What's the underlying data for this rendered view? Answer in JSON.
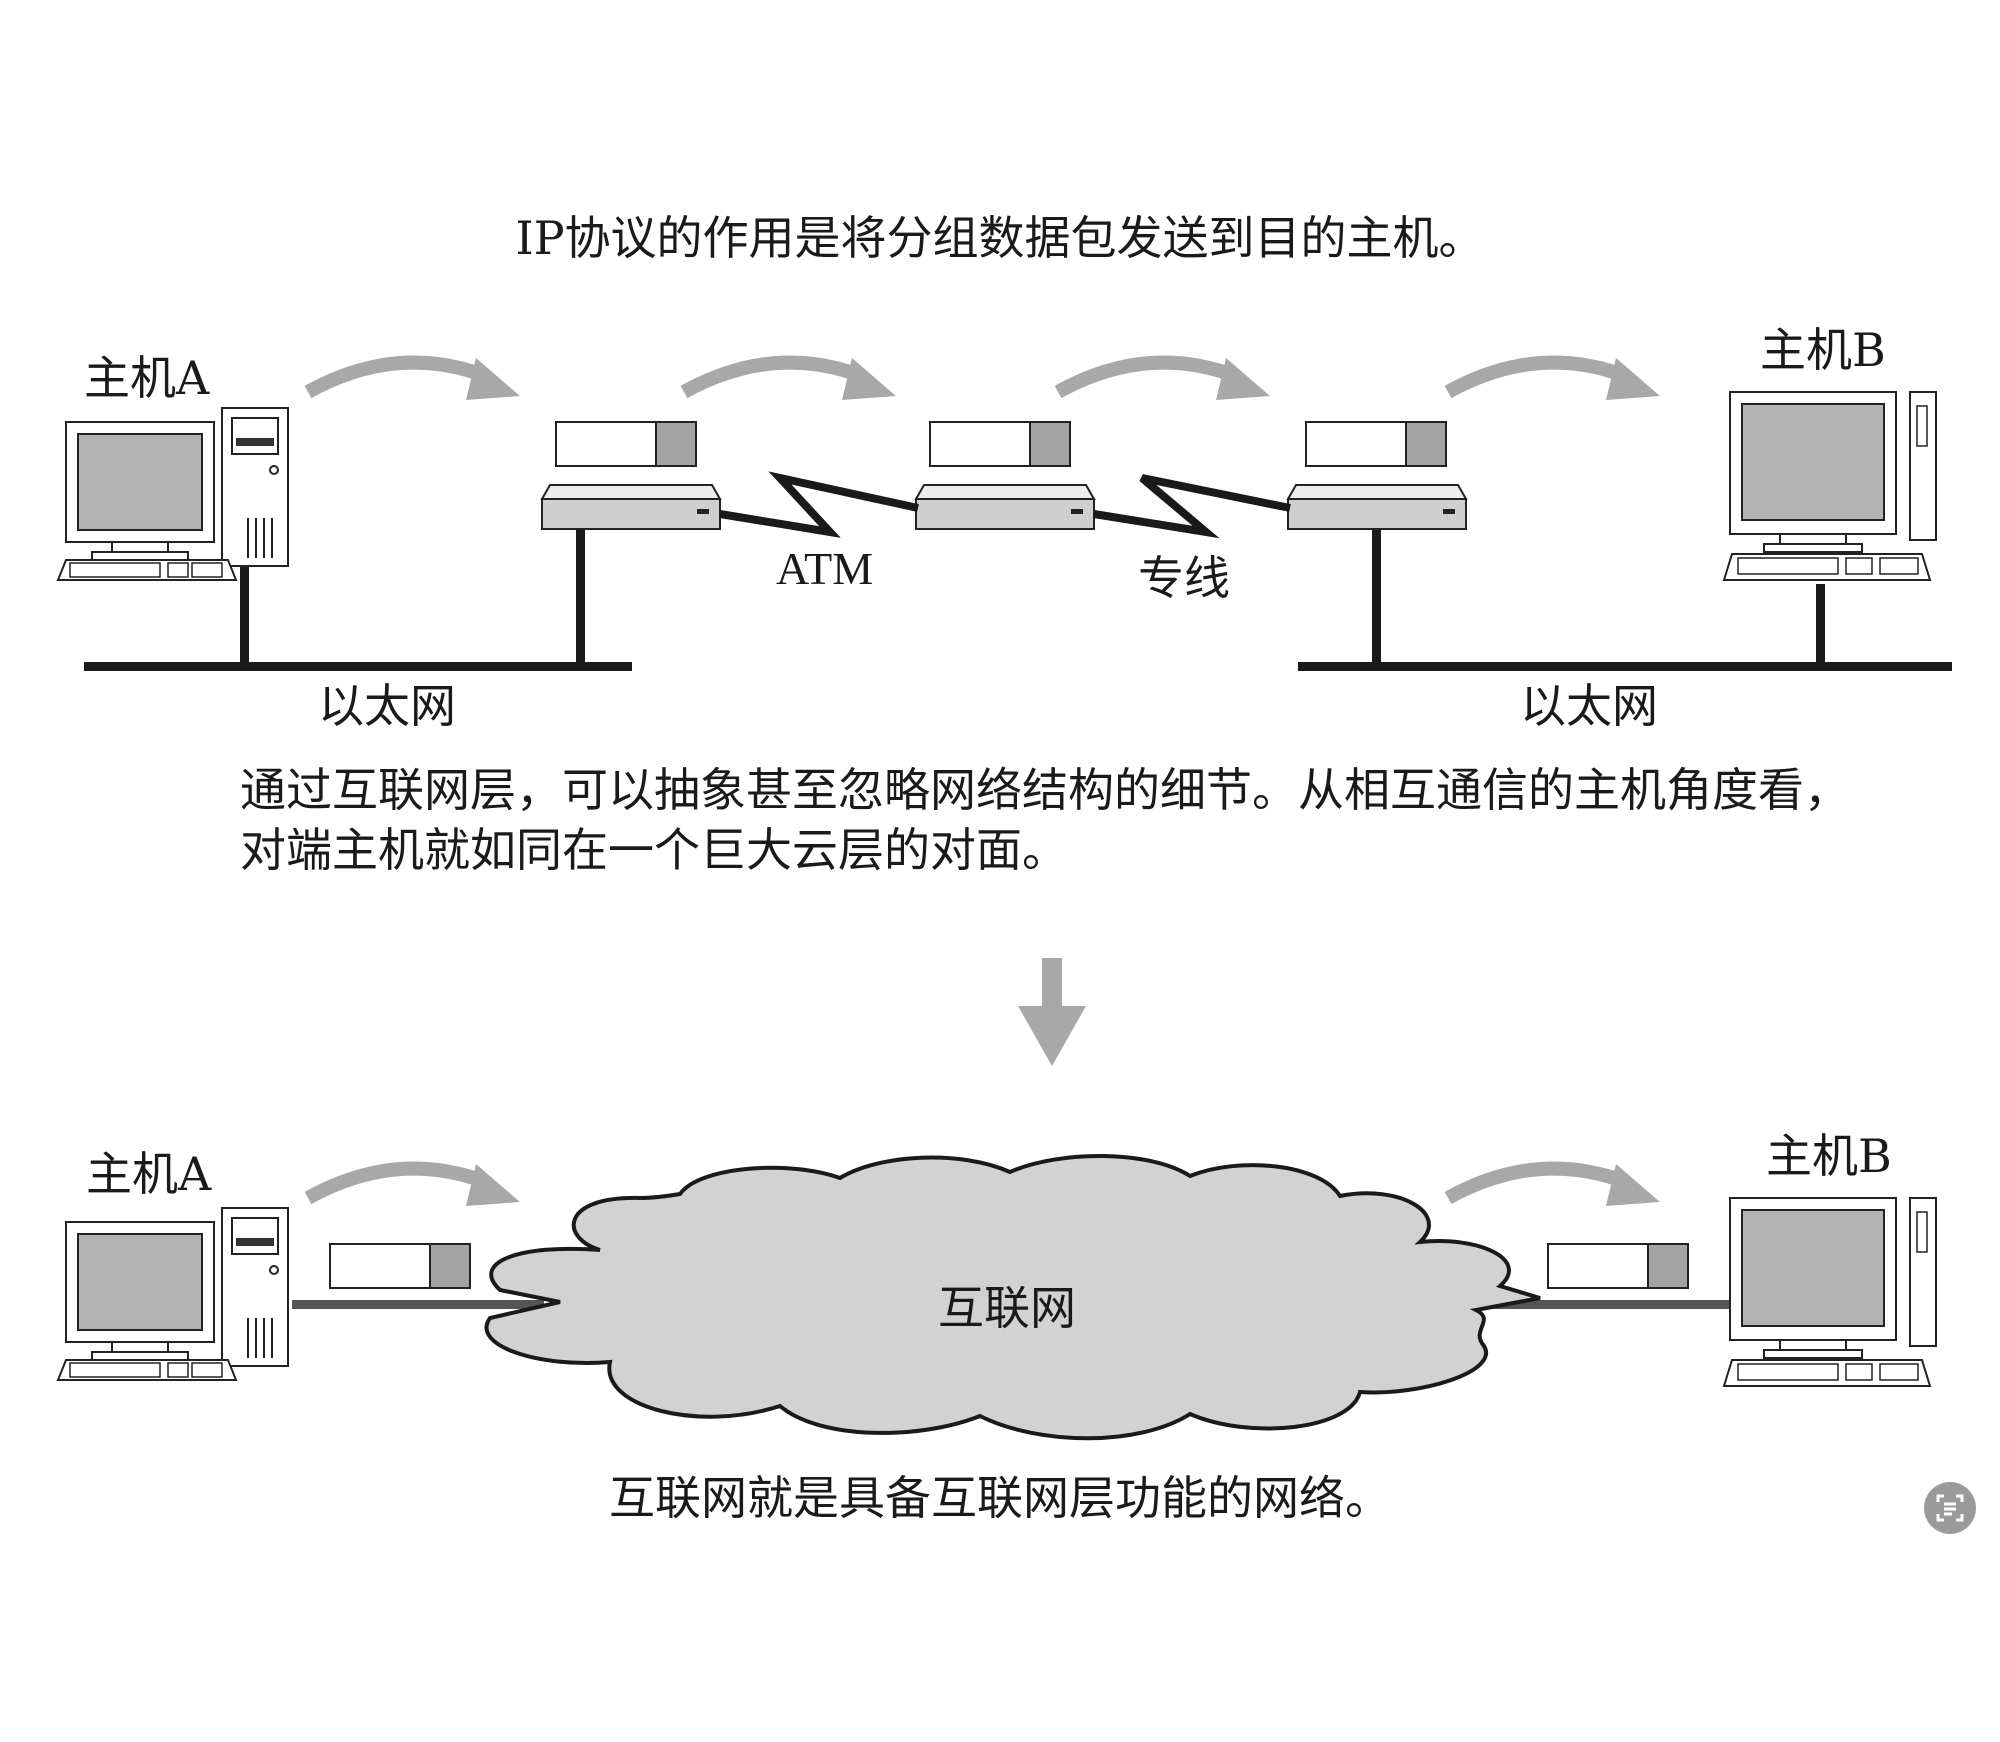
{
  "captions": {
    "top": "IP协议的作用是将分组数据包发送到目的主机。",
    "middle_line1": "通过互联网层，可以抽象甚至忽略网络结构的细节。从相互通信的主机角度看，",
    "middle_line2": "对端主机就如同在一个巨大云层的对面。",
    "bottom": "互联网就是具备互联网层功能的网络。"
  },
  "top_diagram": {
    "host_a": "主机A",
    "host_b": "主机B",
    "link_1": "ATM",
    "link_2": "专线",
    "lan_left": "以太网",
    "lan_right": "以太网"
  },
  "bottom_diagram": {
    "host_a": "主机A",
    "host_b": "主机B",
    "cloud": "互联网"
  },
  "icons": {
    "hosts": "desktop-computer-icon",
    "routers": "router-icon",
    "packets": "packet-icon",
    "badge": "document-scan-icon"
  },
  "colors": {
    "arrow": "#a8a8a8",
    "cloud": "#d2d2d2",
    "packet_tail": "#a3a3a3",
    "screen": "#b4b4b4"
  }
}
